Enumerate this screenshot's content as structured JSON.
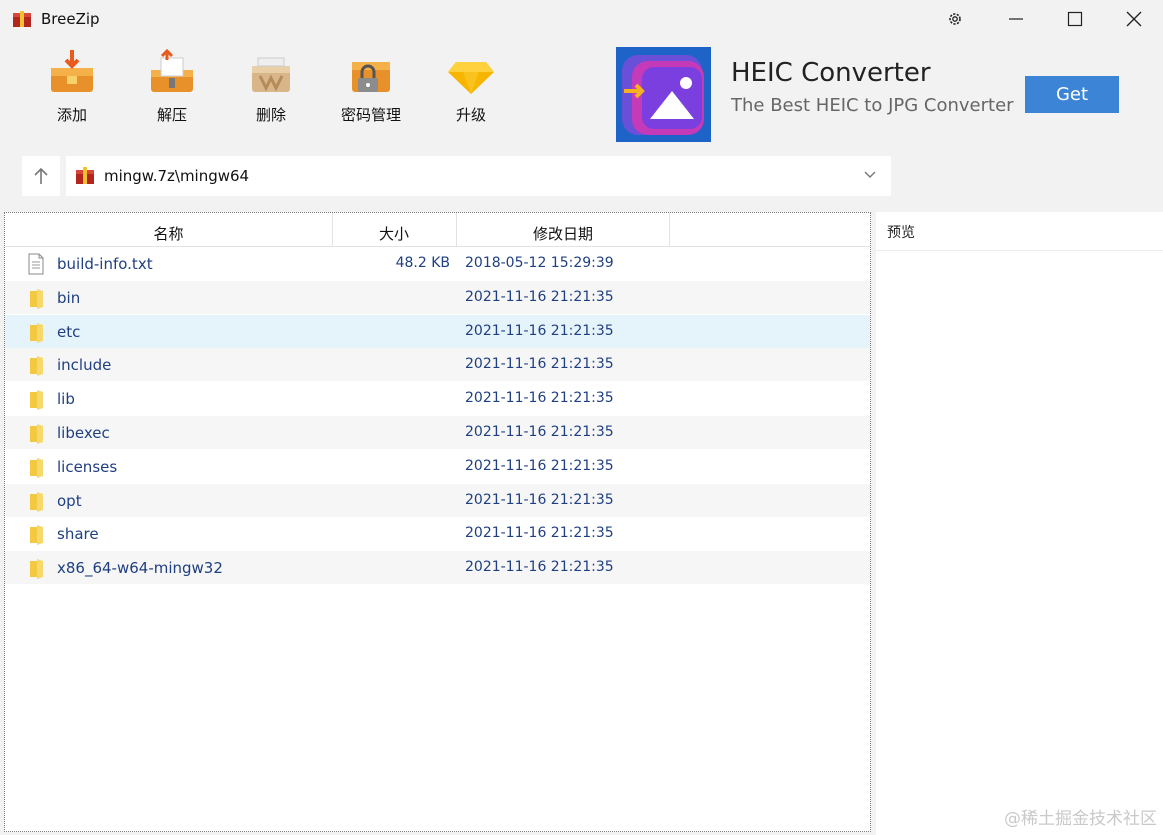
{
  "window": {
    "title": "BreeZip"
  },
  "toolbar": {
    "buttons": [
      {
        "label": "添加",
        "icon": "add-archive-icon"
      },
      {
        "label": "解压",
        "icon": "extract-icon"
      },
      {
        "label": "删除",
        "icon": "delete-icon"
      },
      {
        "label": "密码管理",
        "icon": "password-manager-icon"
      },
      {
        "label": "升级",
        "icon": "upgrade-diamond-icon"
      }
    ]
  },
  "ad": {
    "title": "HEIC Converter",
    "subtitle": "The Best HEIC to JPG Converter",
    "button": "Get"
  },
  "address": {
    "path": "mingw.7z\\mingw64"
  },
  "columns": {
    "name": "名称",
    "size": "大小",
    "modified": "修改日期"
  },
  "files": [
    {
      "name": "build-info.txt",
      "size": "48.2 KB",
      "date": "2018-05-12 15:29:39",
      "type": "file"
    },
    {
      "name": "bin",
      "size": "",
      "date": "2021-11-16 21:21:35",
      "type": "folder"
    },
    {
      "name": "etc",
      "size": "",
      "date": "2021-11-16 21:21:35",
      "type": "folder",
      "selected": true
    },
    {
      "name": "include",
      "size": "",
      "date": "2021-11-16 21:21:35",
      "type": "folder"
    },
    {
      "name": "lib",
      "size": "",
      "date": "2021-11-16 21:21:35",
      "type": "folder"
    },
    {
      "name": "libexec",
      "size": "",
      "date": "2021-11-16 21:21:35",
      "type": "folder"
    },
    {
      "name": "licenses",
      "size": "",
      "date": "2021-11-16 21:21:35",
      "type": "folder"
    },
    {
      "name": "opt",
      "size": "",
      "date": "2021-11-16 21:21:35",
      "type": "folder"
    },
    {
      "name": "share",
      "size": "",
      "date": "2021-11-16 21:21:35",
      "type": "folder"
    },
    {
      "name": "x86_64-w64-mingw32",
      "size": "",
      "date": "2021-11-16 21:21:35",
      "type": "folder"
    }
  ],
  "preview": {
    "label": "预览"
  },
  "watermark": "@稀土掘金技术社区",
  "colors": {
    "accent": "#3c84d6",
    "selection": "#e5f3fb",
    "text_link": "#1f3f82",
    "folder": "#f5c842"
  }
}
